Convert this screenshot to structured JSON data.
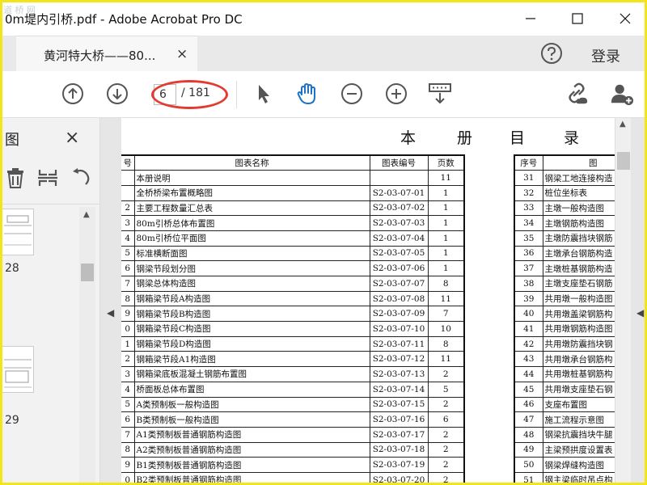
{
  "window": {
    "title": "0m堤内引桥.pdf - Adobe Acrobat Pro DC",
    "watermark": "道 桥 网"
  },
  "tabs": [
    {
      "label": "黄河特大桥——80...",
      "close": "×"
    }
  ],
  "header": {
    "login_label": "登录",
    "help_icon": "question-circle-icon"
  },
  "toolbar": {
    "current_page": "6",
    "total_pages": "/ 181",
    "icons": [
      "prev-page-icon",
      "next-page-icon",
      "select-arrow-icon",
      "hand-tool-icon",
      "zoom-out-icon",
      "zoom-in-icon",
      "keyboard-fit-icon",
      "link-icon",
      "add-user-icon"
    ]
  },
  "sidebar": {
    "title": "图",
    "close": "×",
    "tools": [
      "trash-icon",
      "extract-pages-icon",
      "rotate-icon"
    ],
    "thumbnails": [
      {
        "label": "28"
      },
      {
        "label": "29"
      }
    ]
  },
  "document": {
    "heading_chars": [
      "本",
      "册",
      "目",
      "录"
    ],
    "left_table": {
      "headers": [
        "号",
        "图表名称",
        "图表编号",
        "页数"
      ],
      "rows": [
        [
          "",
          "本册说明",
          "",
          "11"
        ],
        [
          "",
          "全桥桥梁布置概略图",
          "S2-03-07-01",
          "1"
        ],
        [
          "2",
          "主要工程数量汇总表",
          "S2-03-07-02",
          "1"
        ],
        [
          "3",
          "80m引桥总体布置图",
          "S2-03-07-03",
          "1"
        ],
        [
          "4",
          "80m引桥位平面图",
          "S2-03-07-04",
          "1"
        ],
        [
          "5",
          "标准横断面图",
          "S2-03-07-05",
          "1"
        ],
        [
          "6",
          "钢梁节段划分图",
          "S2-03-07-06",
          "1"
        ],
        [
          "7",
          "钢梁总体构造图",
          "S2-03-07-07",
          "8"
        ],
        [
          "8",
          "钢箱梁节段A构造图",
          "S2-03-07-08",
          "11"
        ],
        [
          "9",
          "钢箱梁节段B构造图",
          "S2-03-07-09",
          "7"
        ],
        [
          "0",
          "钢箱梁节段C构造图",
          "S2-03-07-10",
          "10"
        ],
        [
          "1",
          "钢箱梁节段D构造图",
          "S2-03-07-11",
          "8"
        ],
        [
          "2",
          "钢箱梁节段A1构造图",
          "S2-03-07-12",
          "11"
        ],
        [
          "3",
          "钢箱梁底板混凝土钢筋布置图",
          "S2-03-07-13",
          "2"
        ],
        [
          "4",
          "桥面板总体布置图",
          "S2-03-07-14",
          "5"
        ],
        [
          "5",
          "A类预制板一般构造图",
          "S2-03-07-15",
          "2"
        ],
        [
          "6",
          "B类预制板一般构造图",
          "S2-03-07-16",
          "6"
        ],
        [
          "7",
          "A1类预制板普通钢筋构造图",
          "S2-03-07-17",
          "2"
        ],
        [
          "8",
          "A2类预制板普通钢筋构造图",
          "S2-03-07-18",
          "2"
        ],
        [
          "9",
          "B1类预制板普通钢筋构造图",
          "S2-03-07-19",
          "2"
        ],
        [
          "0",
          "B2类预制板普通钢筋构造图",
          "S2-03-07-20",
          "2"
        ]
      ]
    },
    "right_table": {
      "headers": [
        "序号",
        "图"
      ],
      "rows": [
        [
          "31",
          "钢梁工地连接构造"
        ],
        [
          "32",
          "桩位坐标表"
        ],
        [
          "33",
          "主墩一般构造图"
        ],
        [
          "34",
          "主墩钢筋构造图"
        ],
        [
          "35",
          "主墩防震挡块钢筋"
        ],
        [
          "36",
          "主墩承台钢筋构造"
        ],
        [
          "37",
          "主墩桩基钢筋构造"
        ],
        [
          "38",
          "主墩支座垫石钢筋"
        ],
        [
          "39",
          "共用墩一般构造图"
        ],
        [
          "40",
          "共用墩盖梁钢筋构"
        ],
        [
          "41",
          "共用墩钢筋构造图"
        ],
        [
          "42",
          "共用墩防震挡块钢"
        ],
        [
          "43",
          "共用墩承台钢筋构"
        ],
        [
          "44",
          "共用墩桩基钢筋构"
        ],
        [
          "45",
          "共用墩支座垫石钢"
        ],
        [
          "46",
          "支座布置图"
        ],
        [
          "47",
          "施工流程示意图"
        ],
        [
          "48",
          "钢梁抗震挡块牛腿"
        ],
        [
          "49",
          "主梁预拱度设置表"
        ],
        [
          "50",
          "钢梁焊缝构造图"
        ],
        [
          "51",
          "钢主梁临时吊点构"
        ]
      ]
    }
  }
}
